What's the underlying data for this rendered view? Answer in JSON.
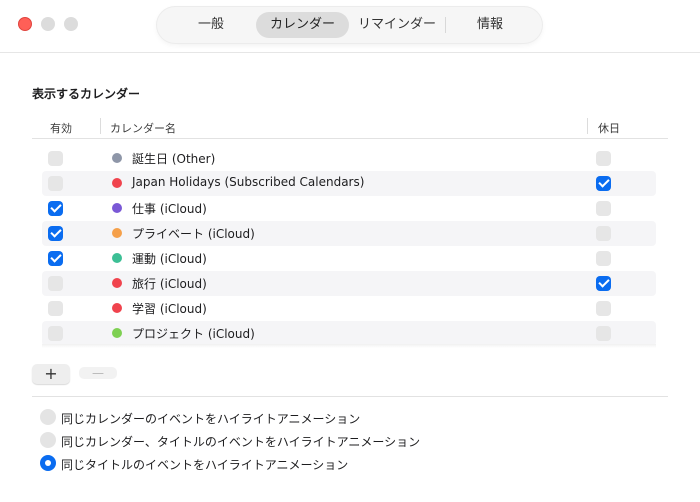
{
  "tabs": [
    {
      "label": "一般"
    },
    {
      "label": "カレンダー"
    },
    {
      "label": "リマインダー"
    },
    {
      "label": "情報"
    }
  ],
  "section": {
    "title": "表示するカレンダー"
  },
  "table": {
    "headers": {
      "enabled": "有効",
      "name": "カレンダー名",
      "holiday": "休日"
    },
    "rows": [
      {
        "name": "誕生日 (Other)",
        "color": "#8e96a8",
        "enabled": false,
        "holiday": false
      },
      {
        "name": "Japan Holidays (Subscribed Calendars)",
        "color": "#f0434d",
        "enabled": false,
        "holiday": true
      },
      {
        "name": "仕事 (iCloud)",
        "color": "#7a58d6",
        "enabled": true,
        "holiday": false
      },
      {
        "name": "プライベート (iCloud)",
        "color": "#f5a04a",
        "enabled": true,
        "holiday": false
      },
      {
        "name": "運動 (iCloud)",
        "color": "#3cbf95",
        "enabled": true,
        "holiday": false
      },
      {
        "name": "旅行 (iCloud)",
        "color": "#f0434d",
        "enabled": false,
        "holiday": true
      },
      {
        "name": "学習 (iCloud)",
        "color": "#f0434d",
        "enabled": false,
        "holiday": false
      },
      {
        "name": "プロジェクト (iCloud)",
        "color": "#7ed052",
        "enabled": false,
        "holiday": false
      }
    ]
  },
  "buttons": {
    "add": "+",
    "remove": "—"
  },
  "options": [
    {
      "label": "同じカレンダーのイベントをハイライトアニメーション",
      "selected": false
    },
    {
      "label": "同じカレンダー、タイトルのイベントをハイライトアニメーション",
      "selected": false
    },
    {
      "label": "同じタイトルのイベントをハイライトアニメーション",
      "selected": true
    }
  ],
  "colors": {
    "accent": "#0a6cf0",
    "close": "#ff5f57"
  }
}
